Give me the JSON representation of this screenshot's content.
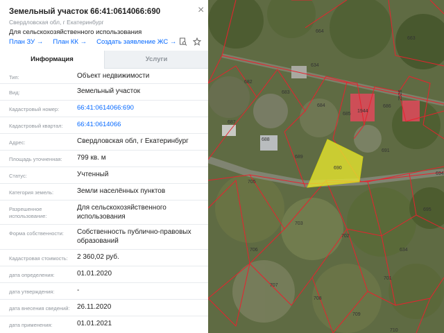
{
  "header": {
    "title": "Земельный участок 66:41:0614066:690",
    "subtitle": "Свердловская обл, г Екатеринбург",
    "purpose": "Для сельскохозяйственного использования",
    "links": [
      "План ЗУ",
      "План КК",
      "Создать заявление ЖС"
    ]
  },
  "tabs": {
    "info": "Информация",
    "services": "Услуги"
  },
  "rows": [
    {
      "label": "Тип:",
      "value": "Объект недвижимости"
    },
    {
      "label": "Вид:",
      "value": "Земельный участок"
    },
    {
      "label": "Кадастровый номер:",
      "value": "66:41:0614066:690"
    },
    {
      "label": "Кадастровый квартал:",
      "value": "66:41:0614066"
    },
    {
      "label": "Адрес:",
      "value": "Свердловская обл, г Екатеринбург"
    },
    {
      "label": "Площадь уточненная:",
      "value": "799 кв. м"
    },
    {
      "label": "Статус:",
      "value": "Учтенный"
    },
    {
      "label": "Категория земель:",
      "value": "Земли населённых пунктов"
    },
    {
      "label": "Разрешенное использование:",
      "value": "Для сельскохозяйственного использования"
    },
    {
      "label": "Форма собственности:",
      "value": "Собственность публично-правовых образований"
    },
    {
      "label": "Кадастровая стоимость:",
      "value": "2 360,02 руб."
    },
    {
      "label": "дата определения:",
      "value": "01.01.2020"
    },
    {
      "label": "дата утверждения:",
      "value": "-"
    },
    {
      "label": "дата внесения сведений:",
      "value": "26.11.2020"
    },
    {
      "label": "дата применения:",
      "value": "01.01.2021"
    }
  ],
  "map": {
    "parcels": [
      "664",
      "663",
      "634",
      "682",
      "683",
      "684",
      "685",
      "1944",
      "686",
      "2526",
      "687",
      "688",
      "689",
      "690",
      "691",
      "694",
      "705",
      "703",
      "702",
      "706",
      "701",
      "634",
      "695",
      "707",
      "708",
      "709",
      "710"
    ],
    "colors": {
      "boundary": "#e8222e",
      "selected_fill": "#e5e52e",
      "selected_stroke": "#cfcf1a",
      "accent": "#0468ff"
    }
  }
}
